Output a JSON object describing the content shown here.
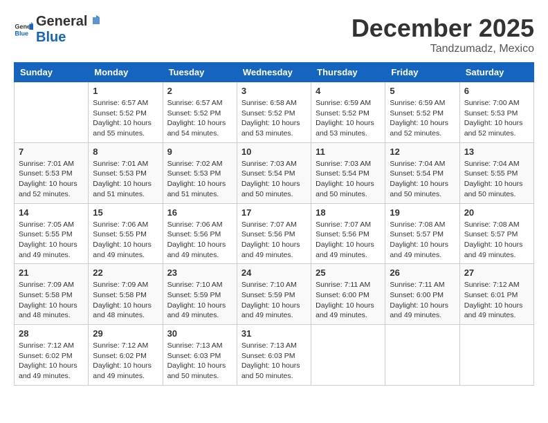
{
  "logo": {
    "general": "General",
    "blue": "Blue"
  },
  "header": {
    "month": "December 2025",
    "location": "Tandzumadz, Mexico"
  },
  "weekdays": [
    "Sunday",
    "Monday",
    "Tuesday",
    "Wednesday",
    "Thursday",
    "Friday",
    "Saturday"
  ],
  "weeks": [
    [
      {
        "day": "",
        "info": ""
      },
      {
        "day": "1",
        "info": "Sunrise: 6:57 AM\nSunset: 5:52 PM\nDaylight: 10 hours\nand 55 minutes."
      },
      {
        "day": "2",
        "info": "Sunrise: 6:57 AM\nSunset: 5:52 PM\nDaylight: 10 hours\nand 54 minutes."
      },
      {
        "day": "3",
        "info": "Sunrise: 6:58 AM\nSunset: 5:52 PM\nDaylight: 10 hours\nand 53 minutes."
      },
      {
        "day": "4",
        "info": "Sunrise: 6:59 AM\nSunset: 5:52 PM\nDaylight: 10 hours\nand 53 minutes."
      },
      {
        "day": "5",
        "info": "Sunrise: 6:59 AM\nSunset: 5:52 PM\nDaylight: 10 hours\nand 52 minutes."
      },
      {
        "day": "6",
        "info": "Sunrise: 7:00 AM\nSunset: 5:53 PM\nDaylight: 10 hours\nand 52 minutes."
      }
    ],
    [
      {
        "day": "7",
        "info": "Sunrise: 7:01 AM\nSunset: 5:53 PM\nDaylight: 10 hours\nand 52 minutes."
      },
      {
        "day": "8",
        "info": "Sunrise: 7:01 AM\nSunset: 5:53 PM\nDaylight: 10 hours\nand 51 minutes."
      },
      {
        "day": "9",
        "info": "Sunrise: 7:02 AM\nSunset: 5:53 PM\nDaylight: 10 hours\nand 51 minutes."
      },
      {
        "day": "10",
        "info": "Sunrise: 7:03 AM\nSunset: 5:54 PM\nDaylight: 10 hours\nand 50 minutes."
      },
      {
        "day": "11",
        "info": "Sunrise: 7:03 AM\nSunset: 5:54 PM\nDaylight: 10 hours\nand 50 minutes."
      },
      {
        "day": "12",
        "info": "Sunrise: 7:04 AM\nSunset: 5:54 PM\nDaylight: 10 hours\nand 50 minutes."
      },
      {
        "day": "13",
        "info": "Sunrise: 7:04 AM\nSunset: 5:55 PM\nDaylight: 10 hours\nand 50 minutes."
      }
    ],
    [
      {
        "day": "14",
        "info": "Sunrise: 7:05 AM\nSunset: 5:55 PM\nDaylight: 10 hours\nand 49 minutes."
      },
      {
        "day": "15",
        "info": "Sunrise: 7:06 AM\nSunset: 5:55 PM\nDaylight: 10 hours\nand 49 minutes."
      },
      {
        "day": "16",
        "info": "Sunrise: 7:06 AM\nSunset: 5:56 PM\nDaylight: 10 hours\nand 49 minutes."
      },
      {
        "day": "17",
        "info": "Sunrise: 7:07 AM\nSunset: 5:56 PM\nDaylight: 10 hours\nand 49 minutes."
      },
      {
        "day": "18",
        "info": "Sunrise: 7:07 AM\nSunset: 5:56 PM\nDaylight: 10 hours\nand 49 minutes."
      },
      {
        "day": "19",
        "info": "Sunrise: 7:08 AM\nSunset: 5:57 PM\nDaylight: 10 hours\nand 49 minutes."
      },
      {
        "day": "20",
        "info": "Sunrise: 7:08 AM\nSunset: 5:57 PM\nDaylight: 10 hours\nand 49 minutes."
      }
    ],
    [
      {
        "day": "21",
        "info": "Sunrise: 7:09 AM\nSunset: 5:58 PM\nDaylight: 10 hours\nand 48 minutes."
      },
      {
        "day": "22",
        "info": "Sunrise: 7:09 AM\nSunset: 5:58 PM\nDaylight: 10 hours\nand 48 minutes."
      },
      {
        "day": "23",
        "info": "Sunrise: 7:10 AM\nSunset: 5:59 PM\nDaylight: 10 hours\nand 49 minutes."
      },
      {
        "day": "24",
        "info": "Sunrise: 7:10 AM\nSunset: 5:59 PM\nDaylight: 10 hours\nand 49 minutes."
      },
      {
        "day": "25",
        "info": "Sunrise: 7:11 AM\nSunset: 6:00 PM\nDaylight: 10 hours\nand 49 minutes."
      },
      {
        "day": "26",
        "info": "Sunrise: 7:11 AM\nSunset: 6:00 PM\nDaylight: 10 hours\nand 49 minutes."
      },
      {
        "day": "27",
        "info": "Sunrise: 7:12 AM\nSunset: 6:01 PM\nDaylight: 10 hours\nand 49 minutes."
      }
    ],
    [
      {
        "day": "28",
        "info": "Sunrise: 7:12 AM\nSunset: 6:02 PM\nDaylight: 10 hours\nand 49 minutes."
      },
      {
        "day": "29",
        "info": "Sunrise: 7:12 AM\nSunset: 6:02 PM\nDaylight: 10 hours\nand 49 minutes."
      },
      {
        "day": "30",
        "info": "Sunrise: 7:13 AM\nSunset: 6:03 PM\nDaylight: 10 hours\nand 50 minutes."
      },
      {
        "day": "31",
        "info": "Sunrise: 7:13 AM\nSunset: 6:03 PM\nDaylight: 10 hours\nand 50 minutes."
      },
      {
        "day": "",
        "info": ""
      },
      {
        "day": "",
        "info": ""
      },
      {
        "day": "",
        "info": ""
      }
    ]
  ]
}
